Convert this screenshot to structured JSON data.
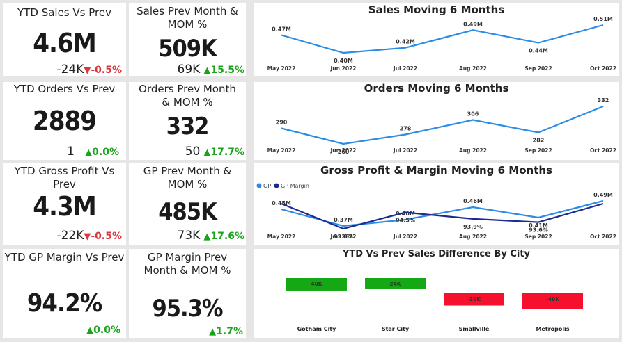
{
  "kpis": [
    {
      "title": "YTD Sales Vs Prev",
      "value": "4.6M",
      "diff": "-24K",
      "arrow": "▼",
      "pct": "-0.5%",
      "dir": "neg"
    },
    {
      "title": "Sales Prev Month & MOM %",
      "value": "509K",
      "diff": "69K",
      "arrow": "▲",
      "pct": "15.5%",
      "dir": "pos"
    },
    {
      "title": "YTD Orders Vs Prev",
      "value": "2889",
      "diff": "1",
      "arrow": "▲",
      "pct": "0.0%",
      "dir": "pos"
    },
    {
      "title": "Orders Prev Month & MOM %",
      "value": "332",
      "diff": "50",
      "arrow": "▲",
      "pct": "17.7%",
      "dir": "pos"
    },
    {
      "title": "YTD Gross Profit Vs Prev",
      "value": "4.3M",
      "diff": "-22K",
      "arrow": "▼",
      "pct": "-0.5%",
      "dir": "neg"
    },
    {
      "title": "GP Prev Month & MOM %",
      "value": "485K",
      "diff": "73K",
      "arrow": "▲",
      "pct": "17.6%",
      "dir": "pos"
    },
    {
      "title": "YTD GP Margin Vs Prev",
      "value": "94.2%",
      "diff": "",
      "arrow": "▲",
      "pct": "0.0%",
      "dir": "pos"
    },
    {
      "title": "GP Margin Prev Month & MOM %",
      "value": "95.3%",
      "diff": "",
      "arrow": "▲",
      "pct": "1.7%",
      "dir": "pos"
    }
  ],
  "colors": {
    "line_light": "#2b8ce6",
    "line_dark": "#1c2a8f",
    "positive": "#1aa31a",
    "negative": "#d9383f",
    "bar_pos": "#14a814",
    "bar_neg": "#f5102e"
  },
  "chart_data": [
    {
      "type": "line",
      "title": "Sales Moving 6 Months",
      "categories": [
        "May 2022",
        "Jun 2022",
        "Jul 2022",
        "Aug 2022",
        "Sep 2022",
        "Oct 2022"
      ],
      "series": [
        {
          "values": [
            0.47,
            0.4,
            0.42,
            0.49,
            0.44,
            0.51
          ],
          "labels": [
            "0.47M",
            "0.40M",
            "0.42M",
            "0.49M",
            "0.44M",
            "0.51M"
          ]
        }
      ]
    },
    {
      "type": "line",
      "title": "Orders Moving 6 Months",
      "categories": [
        "May 2022",
        "Jun 2022",
        "Jul 2022",
        "Aug 2022",
        "Sep 2022",
        "Oct 2022"
      ],
      "series": [
        {
          "values": [
            290,
            260,
            278,
            306,
            282,
            332
          ],
          "labels": [
            "290",
            "260",
            "278",
            "306",
            "282",
            "332"
          ]
        }
      ]
    },
    {
      "type": "line",
      "title": "Gross Profit & Margin Moving 6 Months",
      "categories": [
        "May 2022",
        "Jun 2022",
        "Jul 2022",
        "Aug 2022",
        "Sep 2022",
        "Oct 2022"
      ],
      "legend": [
        "GP",
        "GP Margin"
      ],
      "series": [
        {
          "name": "GP",
          "values": [
            0.45,
            0.37,
            0.4,
            0.46,
            0.41,
            0.49
          ],
          "labels": [
            "0.45M",
            "0.37M",
            "0.40M",
            "0.46M",
            "0.41M",
            "0.49M"
          ]
        },
        {
          "name": "GP Margin",
          "values": [
            95.3,
            93.0,
            94.5,
            93.9,
            93.6,
            95.3
          ],
          "labels": [
            "",
            "93.0%",
            "94.5%",
            "93.9%",
            "93.6%",
            ""
          ]
        }
      ]
    },
    {
      "type": "bar",
      "title": "YTD Vs Prev Sales Difference By City",
      "categories": [
        "Gotham City",
        "Star City",
        "Smallville",
        "Metropolis"
      ],
      "values": [
        40,
        24,
        -39,
        -49
      ],
      "labels": [
        "40K",
        "24K",
        "-39K",
        "-49K"
      ]
    }
  ]
}
